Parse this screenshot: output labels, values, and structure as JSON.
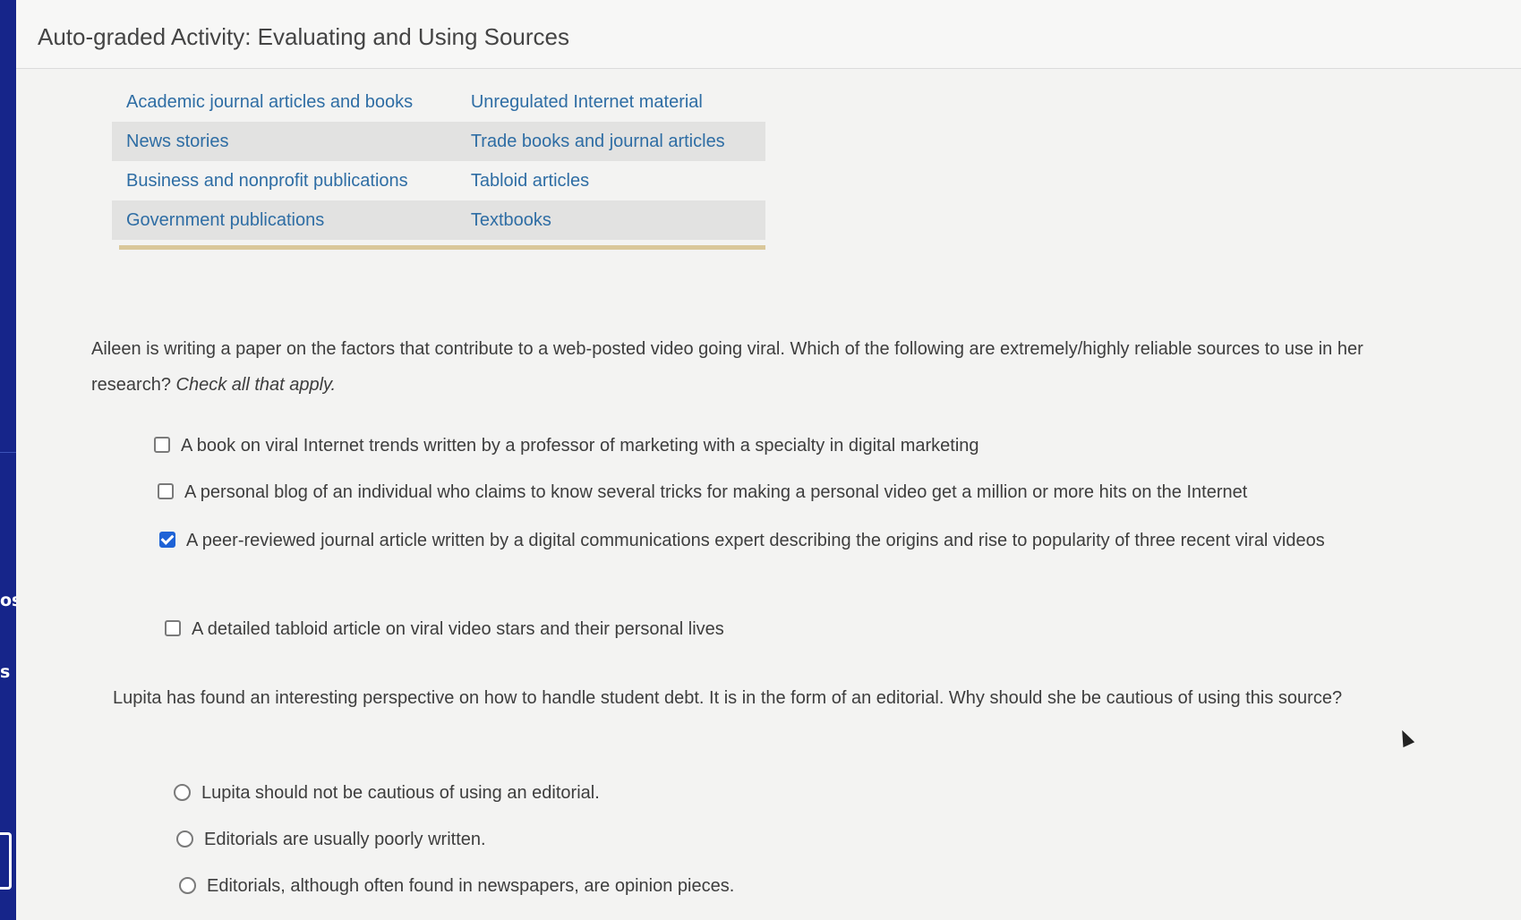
{
  "header": {
    "title": "Auto-graded Activity: Evaluating and Using Sources"
  },
  "left_rail": {
    "labels": [
      "os",
      "s"
    ]
  },
  "sources_table": {
    "rows": [
      [
        "Academic journal articles and books",
        "Unregulated Internet material"
      ],
      [
        "News stories",
        "Trade books and journal articles"
      ],
      [
        "Business and nonprofit publications",
        "Tabloid articles"
      ],
      [
        "Government publications",
        "Textbooks"
      ]
    ]
  },
  "question1": {
    "prompt": "Aileen is writing a paper on the factors that contribute to a web-posted video going viral. Which of the following are extremely/highly reliable sources to use in her research?",
    "instruction": "Check all that apply.",
    "options": [
      {
        "label": "A book on viral Internet trends written by a professor of marketing with a specialty in digital marketing",
        "checked": false
      },
      {
        "label": "A personal blog of an individual who claims to know several tricks for making a personal video get a million or more hits on the Internet",
        "checked": false
      },
      {
        "label": "A peer-reviewed journal article written by a digital communications expert describing the origins and rise to popularity of three recent viral videos",
        "checked": true
      },
      {
        "label": "A detailed tabloid article on viral video stars and their personal lives",
        "checked": false
      }
    ]
  },
  "question2": {
    "prompt": "Lupita has found an interesting perspective on how to handle student debt. It is in the form of an editorial. Why should she be cautious of using this source?",
    "options": [
      {
        "label": "Lupita should not be cautious of using an editorial.",
        "selected": false
      },
      {
        "label": "Editorials are usually poorly written.",
        "selected": false
      },
      {
        "label": "Editorials, although often found in newspapers, are opinion pieces.",
        "selected": false
      }
    ]
  },
  "colors": {
    "link": "#2e6da4",
    "accent_checked": "#1e63d6",
    "rail": "#1a2c8c"
  }
}
